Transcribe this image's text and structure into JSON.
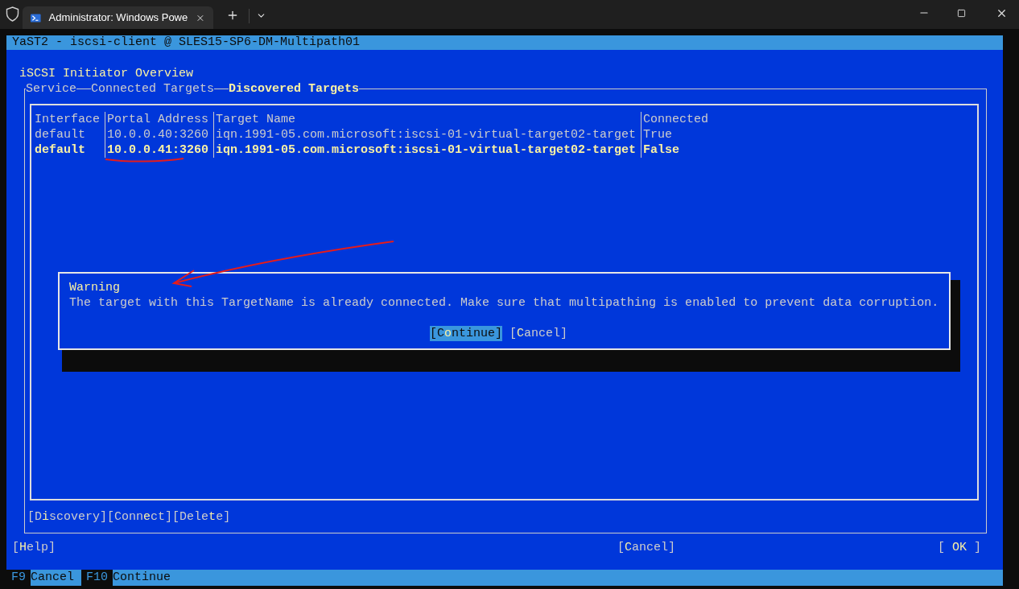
{
  "terminal_tabs": [
    {
      "title": "Administrator: Windows Powe",
      "selected": true
    }
  ],
  "yast_title": "YaST2 - iscsi-client @ SLES15-SP6-DM-Multipath01",
  "heading": "iSCSI Initiator Overview",
  "section_tabs": [
    {
      "label": "Service",
      "selected": false
    },
    {
      "label": "Connected Targets",
      "selected": false
    },
    {
      "label": "Discovered Targets",
      "selected": true
    }
  ],
  "table": {
    "columns": [
      "Interface",
      "Portal Address",
      "Target Name",
      "Connected"
    ],
    "rows": [
      {
        "cells": [
          "default",
          "10.0.0.40:3260",
          "iqn.1991-05.com.microsoft:iscsi-01-virtual-target02-target",
          "True"
        ],
        "selected": false
      },
      {
        "cells": [
          "default",
          "10.0.0.41:3260",
          "iqn.1991-05.com.microsoft:iscsi-01-virtual-target02-target",
          "False"
        ],
        "selected": true
      }
    ]
  },
  "table_buttons": [
    {
      "parts": [
        "[D",
        "i",
        "scovery]"
      ]
    },
    {
      "parts": [
        "[Conn",
        "e",
        "ct]"
      ]
    },
    {
      "parts": [
        "[Dele",
        "t",
        "e]"
      ]
    }
  ],
  "dialog": {
    "title": "Warning",
    "message": "The target with this TargetName is already connected. Make sure that multipathing is enabled to prevent data corruption.",
    "buttons": [
      {
        "parts": [
          "[C",
          "o",
          "ntinue]"
        ],
        "focused": true
      },
      {
        "parts": [
          "[",
          "C",
          "ancel]"
        ],
        "focused": false
      }
    ]
  },
  "help_button": {
    "parts": [
      "[",
      "H",
      "elp]"
    ]
  },
  "cancel_button": {
    "parts": [
      "[",
      "C",
      "ancel]"
    ]
  },
  "ok_button": {
    "parts": [
      "[ ",
      "OK",
      " ]"
    ]
  },
  "function_keys": [
    {
      "key": "F9",
      "label": "Cancel"
    },
    {
      "key": "F10",
      "label": "Continue"
    }
  ]
}
